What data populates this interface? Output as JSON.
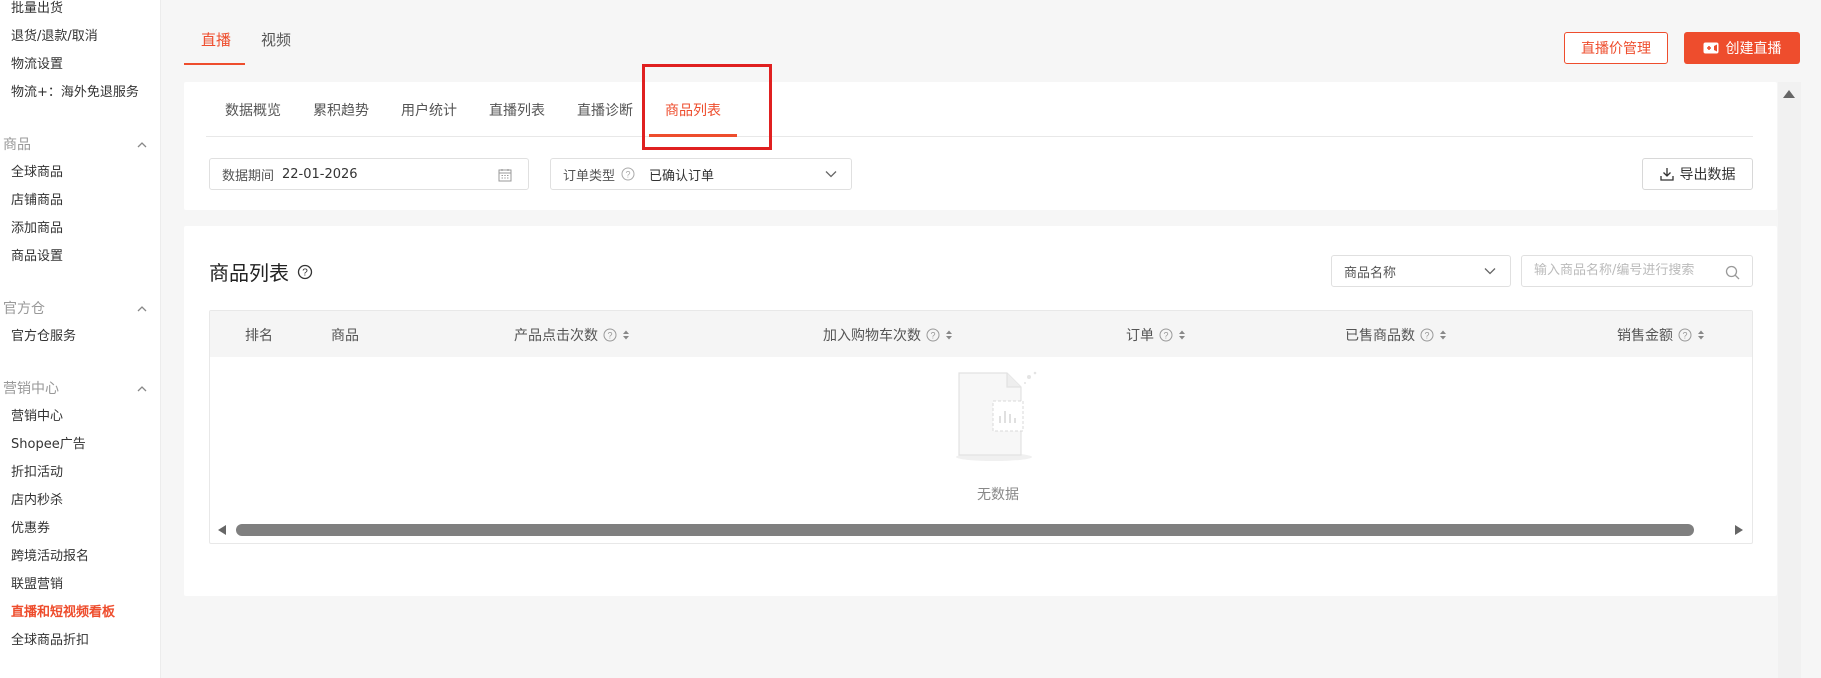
{
  "sidebar": {
    "items_top": [
      "批量出货",
      "退货/退款/取消",
      "物流设置",
      "物流+：海外免退服务"
    ],
    "sections": [
      {
        "title": "商品",
        "items": [
          "全球商品",
          "店铺商品",
          "添加商品",
          "商品设置"
        ]
      },
      {
        "title": "官方仓",
        "items": [
          "官方仓服务"
        ]
      },
      {
        "title": "营销中心",
        "items": [
          "营销中心",
          "Shopee广告",
          "折扣活动",
          "店内秒杀",
          "优惠券",
          "跨境活动报名",
          "联盟营销",
          "直播和短视频看板",
          "全球商品折扣"
        ]
      }
    ],
    "active_item": "直播和短视频看板"
  },
  "top_tabs": [
    "直播",
    "视频"
  ],
  "header_buttons": {
    "price_manage": "直播价管理",
    "create_live": "创建直播"
  },
  "sub_tabs": [
    "数据概览",
    "累积趋势",
    "用户统计",
    "直播列表",
    "直播诊断",
    "商品列表"
  ],
  "filters": {
    "period_label": "数据期间",
    "period_value": "22-01-2026",
    "order_type_label": "订单类型",
    "order_type_value": "已确认订单",
    "export_label": "导出数据"
  },
  "product_list": {
    "title": "商品列表",
    "search_field_select": "商品名称",
    "search_placeholder": "输入商品名称/编号进行搜索",
    "columns": [
      "排名",
      "商品",
      "产品点击次数",
      "加入购物车次数",
      "订单",
      "已售商品数",
      "销售金额"
    ],
    "empty_text": "无数据"
  },
  "colors": {
    "accent": "#ee4d2d",
    "highlight_box": "#e02020"
  }
}
